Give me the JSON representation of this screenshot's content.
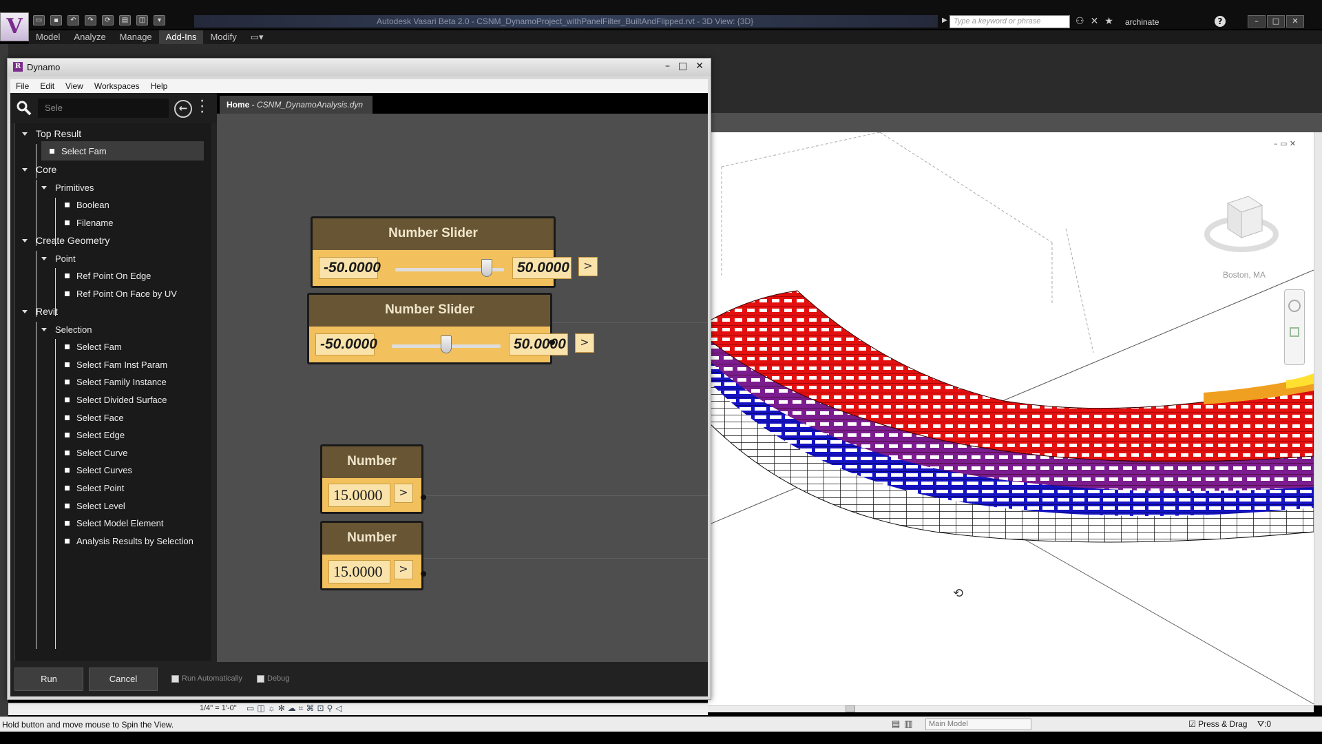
{
  "revit": {
    "app_logo": "V",
    "window_title": "Autodesk Vasari Beta 2.0  -   CSNM_DynamoProject_withPanelFilter_BuiltAndFlipped.rvt - 3D View: {3D}",
    "search_placeholder": "Type a keyword or phrase",
    "user": "archinate",
    "ribbon_tabs": [
      "Model",
      "Analyze",
      "Manage",
      "Add-Ins",
      "Modify"
    ],
    "active_tab": "Add-Ins",
    "viewcube_location": "Boston, MA",
    "scale": "1/4\" = 1'-0\"",
    "status_text": "Hold button and move mouse to Spin the View.",
    "main_model": "Main Model",
    "press_drag": "Press & Drag",
    "filter_count": ":0"
  },
  "dynamo": {
    "title": "Dynamo",
    "menu": [
      "File",
      "Edit",
      "View",
      "Workspaces",
      "Help"
    ],
    "search_value": "Sele",
    "tab": {
      "home": "Home",
      "separator": " - ",
      "file": "CSNM_DynamoAnalysis.dyn"
    },
    "library": {
      "top_result": "Top Result",
      "top_result_item": "Select Fam",
      "core": "Core",
      "primitives": "Primitives",
      "boolean": "Boolean",
      "filename": "Filename",
      "create_geometry": "Create Geometry",
      "point": "Point",
      "ref_point_edge": "Ref Point On Edge",
      "ref_point_face": "Ref Point On Face by UV",
      "revit": "Revit",
      "selection": "Selection",
      "selection_items": [
        "Select Fam",
        "Select Fam Inst Param",
        "Select Family Instance",
        "Select Divided Surface",
        "Select Face",
        "Select Edge",
        "Select Curve",
        "Select Curves",
        "Select Point",
        "Select Level",
        "Select Model Element",
        "Analysis Results by Selection"
      ]
    },
    "nodes": {
      "slider1": {
        "title": "Number Slider",
        "min": "-50.0000",
        "max": "50.0000",
        "value": 34,
        "arrow": ">"
      },
      "slider2": {
        "title": "Number Slider",
        "min": "-50.0000",
        "max": "50.0000",
        "value": 0,
        "arrow": ">"
      },
      "number1": {
        "title": "Number",
        "value": "15.0000",
        "arrow": ">"
      },
      "number2": {
        "title": "Number",
        "value": "15.0000",
        "arrow": ">"
      }
    },
    "footer": {
      "run": "Run",
      "cancel": "Cancel",
      "run_auto": "Run Automatically",
      "debug": "Debug"
    }
  },
  "colors": {
    "node_header": "#685533",
    "node_body": "#f2c15d",
    "panel_red": "#e4100f",
    "panel_purple": "#7b1c8f",
    "panel_blue": "#1512c4"
  }
}
